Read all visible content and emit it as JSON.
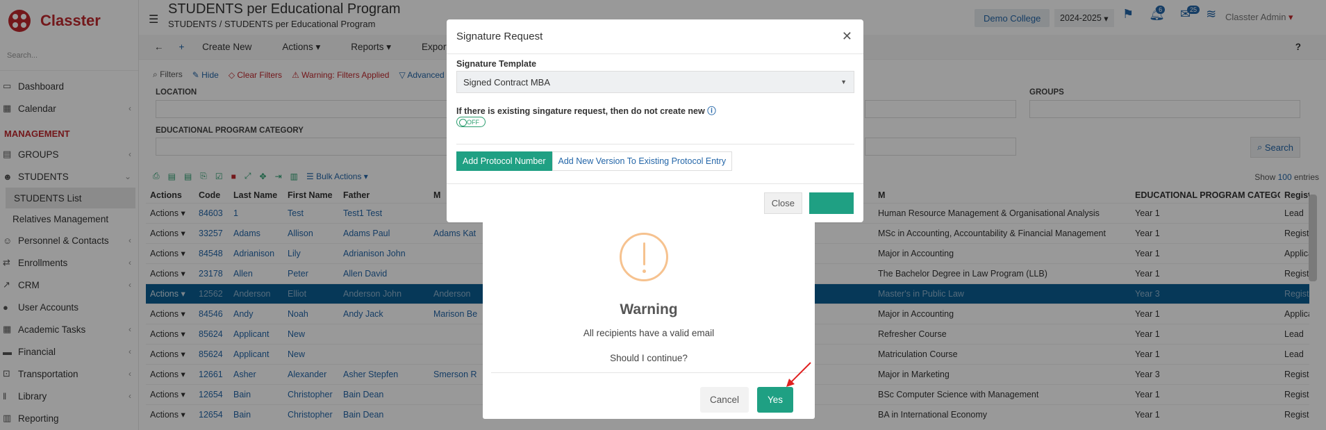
{
  "app": {
    "name": "Classter",
    "search_placeholder": "Search..."
  },
  "sidebar": {
    "items": [
      {
        "label": "Dashboard",
        "icon": "monitor-icon"
      },
      {
        "label": "Calendar",
        "icon": "calendar-icon"
      }
    ],
    "section": "MANAGEMENT",
    "mgmt": [
      {
        "label": "GROUPS",
        "icon": "groups-icon"
      },
      {
        "label": "STUDENTS",
        "icon": "students-icon"
      }
    ],
    "students_sub": [
      "STUDENTS List",
      "Relatives Management"
    ],
    "rest": [
      {
        "label": "Personnel & Contacts"
      },
      {
        "label": "Enrollments"
      },
      {
        "label": "CRM"
      },
      {
        "label": "User Accounts"
      },
      {
        "label": "Academic Tasks"
      },
      {
        "label": "Financial"
      },
      {
        "label": "Transportation"
      },
      {
        "label": "Library"
      },
      {
        "label": "Reporting"
      }
    ]
  },
  "header": {
    "title": "STUDENTS per Educational Program",
    "breadcrumb_1": "STUDENTS",
    "breadcrumb_sep": "/",
    "breadcrumb_2": "STUDENTS per Educational Program",
    "college": "Demo College",
    "year": "2024-2025",
    "notif_count": "6",
    "msg_count": "25",
    "user": "Classter Admin"
  },
  "toolbar": {
    "create": "Create New",
    "actions": "Actions",
    "reports": "Reports",
    "exports": "Exports",
    "help": "?"
  },
  "filters": {
    "filters": "Filters",
    "hide": "Hide",
    "clear": "Clear Filters",
    "warning": "Warning: Filters Applied",
    "advanced": "Advanced Fi",
    "location": "LOCATION",
    "groups": "GROUPS",
    "ep_category": "EDUCATIONAL PROGRAM CATEGORY",
    "search": "Search",
    "bulk": "Bulk Actions",
    "show": "Show",
    "show_n": "100",
    "entries": "entries"
  },
  "table": {
    "headers": [
      "Actions",
      "Code",
      "Last Name",
      "First Name",
      "Father",
      "M",
      "M",
      "EDUCATIONAL PROGRAM CATEGORY",
      "Registration Status"
    ],
    "rows": [
      {
        "a": "Actions",
        "code": "84603",
        "last": "1",
        "first": "Test",
        "father": "Test1 Test",
        "mother": "",
        "prog": "Human Resource Management & Organisational Analysis",
        "cat": "Year 1",
        "status": "Lead"
      },
      {
        "a": "Actions",
        "code": "33257",
        "last": "Adams",
        "first": "Allison",
        "father": "Adams Paul",
        "mother": "Adams Kat",
        "prog": "MSc in Accounting, Accountability & Financial Management",
        "cat": "Year 1",
        "status": "Registered"
      },
      {
        "a": "Actions",
        "code": "84548",
        "last": "Adrianison",
        "first": "Lily",
        "father": "Adrianison John",
        "mother": "",
        "prog": "Major in Accounting",
        "cat": "Year 1",
        "status": "Applicant Accept"
      },
      {
        "a": "Actions",
        "code": "23178",
        "last": "Allen",
        "first": "Peter",
        "father": "Allen David",
        "mother": "",
        "prog": "The Bachelor Degree in Law Program (LLB)",
        "cat": "Year 1",
        "status": "Registered"
      },
      {
        "a": "Actions",
        "code": "12562",
        "last": "Anderson",
        "first": "Elliot",
        "father": "Anderson John",
        "mother": "Anderson",
        "prog": "Master's in Public Law",
        "cat": "Year 3",
        "status": "Registered"
      },
      {
        "a": "Actions",
        "code": "84546",
        "last": "Andy",
        "first": "Noah",
        "father": "Andy Jack",
        "mother": "Marison Be",
        "prog": "Major in Accounting",
        "cat": "Year 1",
        "status": "Applicant Accept"
      },
      {
        "a": "Actions",
        "code": "85624",
        "last": "Applicant",
        "first": "New",
        "father": "",
        "mother": "",
        "prog": "Refresher Course",
        "cat": "Year 1",
        "status": "Lead"
      },
      {
        "a": "Actions",
        "code": "85624",
        "last": "Applicant",
        "first": "New",
        "father": "",
        "mother": "",
        "prog": "Matriculation Course",
        "cat": "Year 1",
        "status": "Lead"
      },
      {
        "a": "Actions",
        "code": "12661",
        "last": "Asher",
        "first": "Alexander",
        "father": "Asher Stepfen",
        "mother": "Smerson R",
        "prog": "Major in Marketing",
        "cat": "Year 3",
        "status": "Registered"
      },
      {
        "a": "Actions",
        "code": "12654",
        "last": "Bain",
        "first": "Christopher",
        "father": "Bain Dean",
        "mother": "",
        "prog": "BSc Computer Science with Management",
        "cat": "Year 1",
        "status": "Registered"
      },
      {
        "a": "Actions",
        "code": "12654",
        "last": "Bain",
        "first": "Christopher",
        "father": "Bain Dean",
        "mother": "",
        "prog": "BA in International Economy",
        "cat": "Year 1",
        "status": "Registered"
      }
    ]
  },
  "sig_modal": {
    "title": "Signature Request",
    "template_label": "Signature Template",
    "template_value": "Signed Contract MBA",
    "existing_label": "If there is existing singature request, then do not create new",
    "toggle": "OFF",
    "add_protocol": "Add Protocol Number",
    "add_version": "Add New Version To Existing Protocol Entry",
    "close": "Close"
  },
  "warning": {
    "title": "Warning",
    "msg1": "All recipients have a valid email",
    "msg2": "Should I continue?",
    "cancel": "Cancel",
    "yes": "Yes"
  },
  "colors": {
    "brand_red": "#c0282d",
    "link_blue": "#2466a8",
    "teal": "#1fa083",
    "warn_orange": "#f6c28f",
    "select_row": "#0b5e93"
  }
}
